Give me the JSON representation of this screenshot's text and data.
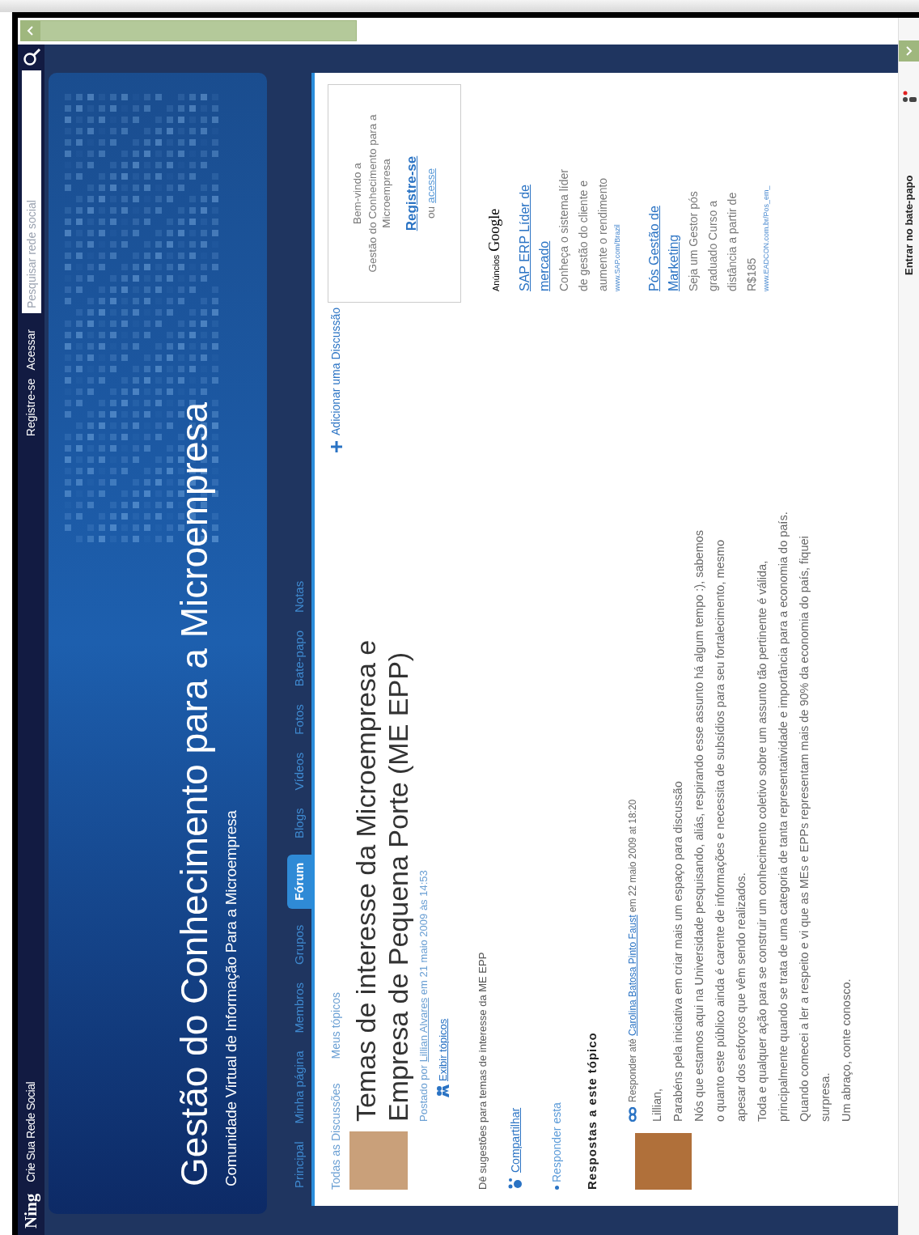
{
  "top_bar": {
    "logo": "Ning",
    "tagline": "Crie Sua Rede Social",
    "links": [
      "Registre-se",
      "Acessar"
    ],
    "search": {
      "placeholder": "Pesquisar rede social"
    }
  },
  "banner": {
    "title": "Gestão do Conhecimento para a Microempresa",
    "subtitle": "Comunidade Virtual de Informação Para a Microempresa"
  },
  "nav_tabs": [
    {
      "label": "Principal",
      "selected": false
    },
    {
      "label": "Minha página",
      "selected": false
    },
    {
      "label": "Membros",
      "selected": false
    },
    {
      "label": "Grupos",
      "selected": false
    },
    {
      "label": "Fórum",
      "selected": true
    },
    {
      "label": "Blogs",
      "selected": false
    },
    {
      "label": "Vídeos",
      "selected": false
    },
    {
      "label": "Fotos",
      "selected": false
    },
    {
      "label": "Bate-papo",
      "selected": false
    },
    {
      "label": "Notas",
      "selected": false
    }
  ],
  "forum": {
    "sub_links": [
      "Todas as Discussões",
      "Meus tópicos"
    ],
    "add_link": "Adicionar uma Discussão",
    "topic": {
      "title": "Temas de interesse da Microempresa e Empresa de Pequena Porte (ME EPP)",
      "posted_by": "Postado por",
      "author": "Lillian Alvares",
      "posted_at": "em 21 maio 2009 às 14:53",
      "view_topics": "Exibir tópicos",
      "description": "Dê sugestões para temas de interesse da ME EPP",
      "share": "Compartilhar",
      "reply": "Responder esta"
    },
    "replies_heading": "Respostas a este tópico",
    "replies": [
      {
        "reply_label": "Responder até",
        "author": "Carolina Batosa Pinto Faust",
        "date": "em 22 maio 2009 at 18:20",
        "lines": [
          "Lillian,",
          "Parabéns pela iniciativa em criar mais um espaço para discussão",
          "Nós que estamos aqui na Universidade pesquisando, aliás, respirando esse assunto há algum tempo :), sabemos",
          "o quanto este público ainda é carente de informações e necessita de subsídios para seu fortalecimento, mesmo",
          "apesar dos esforços que vêm sendo realizados.",
          "Toda e qualquer ação para se construir um conhecimento coletivo sobre um assunto tão pertinente é válida,",
          "principalmente quando se trata de uma categoria de tanta representatividade e importância para a economia do país.",
          "Quando comecei a ler a respeito e vi que as MEs e EPPs representam mais de 90% da economia do país, fiquei",
          "surpresa.",
          "Um abraço, conte conosco."
        ]
      }
    ]
  },
  "sidebar": {
    "welcome": {
      "greeting": "Bem-vindo a",
      "site": "Gestão do Conhecimento para a Microempresa",
      "register": "Registre-se",
      "or": "ou",
      "login": "acesse"
    },
    "ads": {
      "label": "Anúncios",
      "provider": "Google",
      "items": [
        {
          "title": "SAP ERP Líder de mercado",
          "text": "Conheça o sistema líder de gestão do cliente e aumente o rendimento",
          "url": "www.SAP.com/Brazil"
        },
        {
          "title": "Pós Gestão de Marketing",
          "text": "Seja um Gestor pós graduado Curso a distância a partir de R$185",
          "url": "www.EADCON.com.br/Pos_em_"
        }
      ]
    }
  },
  "chat_bar": {
    "label": "Entrar no bate-papo"
  }
}
